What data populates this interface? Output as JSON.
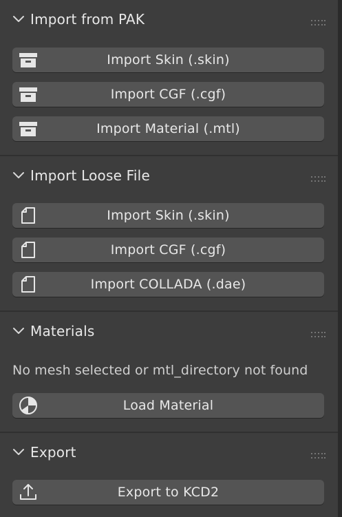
{
  "sections": {
    "import_pak": {
      "title": "Import from PAK",
      "buttons": [
        {
          "label": "Import Skin (.skin)",
          "icon": "archive-box-icon"
        },
        {
          "label": "Import CGF (.cgf)",
          "icon": "archive-box-icon"
        },
        {
          "label": "Import Material (.mtl)",
          "icon": "archive-box-icon"
        }
      ]
    },
    "import_loose": {
      "title": "Import Loose File",
      "buttons": [
        {
          "label": "Import Skin (.skin)",
          "icon": "file-icon"
        },
        {
          "label": "Import CGF (.cgf)",
          "icon": "file-icon"
        },
        {
          "label": "Import COLLADA (.dae)",
          "icon": "file-icon"
        }
      ]
    },
    "materials": {
      "title": "Materials",
      "info": "No mesh selected or mtl_directory not found",
      "buttons": [
        {
          "label": "Load Material",
          "icon": "material-sphere-icon"
        }
      ]
    },
    "export": {
      "title": "Export",
      "buttons": [
        {
          "label": "Export to KCD2",
          "icon": "export-upload-icon"
        }
      ]
    }
  },
  "colors": {
    "background": "#303030",
    "panel": "#3d3d3d",
    "button": "#545454",
    "text": "#e8e8e8"
  }
}
